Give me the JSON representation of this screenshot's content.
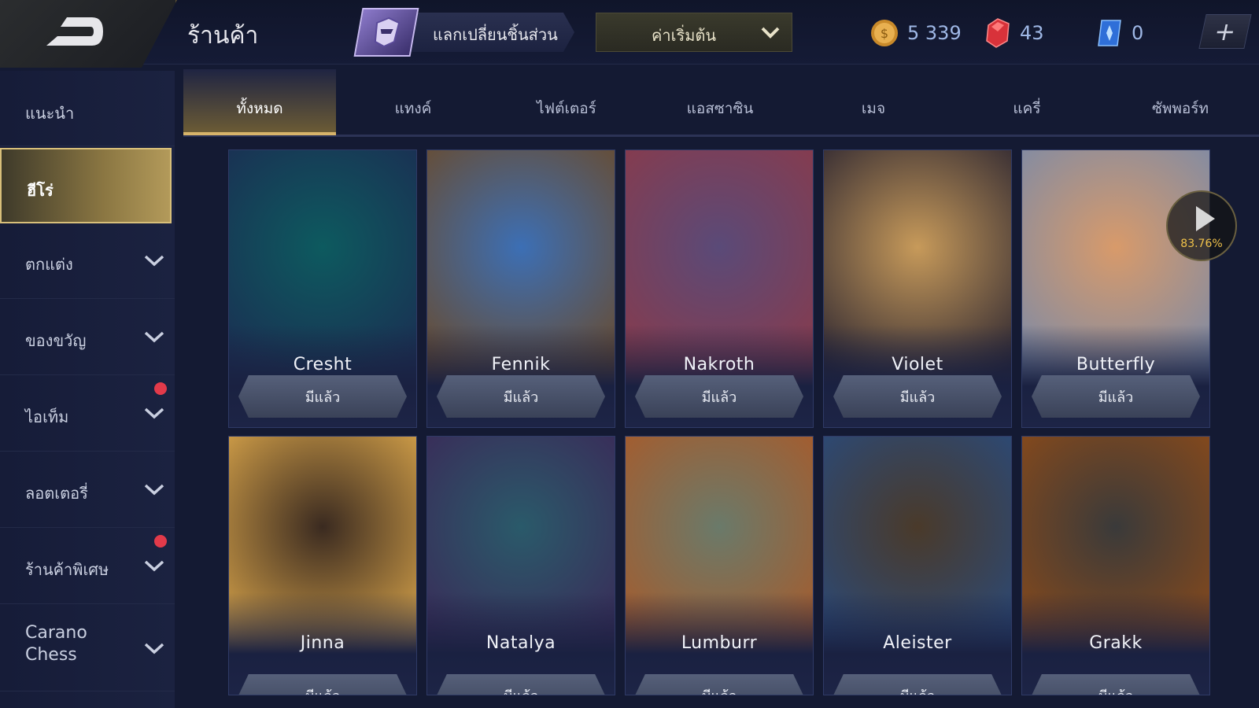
{
  "header": {
    "title": "ร้านค้า",
    "exchange_label": "แลกเปลี่ยนชิ้นส่วน",
    "sort_label": "ค่าเริ่มต้น",
    "currencies": [
      {
        "name": "gold-coin",
        "value": "5 339",
        "color": "#e2a23a"
      },
      {
        "name": "red-gem",
        "value": "43",
        "color": "#e03a3a"
      },
      {
        "name": "blue-voucher",
        "value": "0",
        "color": "#3a7ee0"
      }
    ],
    "plus_label": "+"
  },
  "sidebar": {
    "items": [
      {
        "label": "แนะนำ"
      },
      {
        "label": "ฮีโร่"
      },
      {
        "label": "ตกแต่ง"
      },
      {
        "label": "ของขวัญ"
      },
      {
        "label": "ไอเท็ม"
      },
      {
        "label": "ลอตเตอรี่"
      },
      {
        "label": "ร้านค้าพิเศษ"
      },
      {
        "label": "Carano Chess"
      }
    ]
  },
  "tabs": [
    {
      "label": "ทั้งหมด"
    },
    {
      "label": "แทงค์"
    },
    {
      "label": "ไฟต์เตอร์"
    },
    {
      "label": "แอสซาซิน"
    },
    {
      "label": "เมจ"
    },
    {
      "label": "แครี่"
    },
    {
      "label": "ซัพพอร์ท"
    }
  ],
  "heroes": [
    {
      "name": "Cresht",
      "status": "มีแล้ว",
      "c1": "#0d5a5f",
      "c2": "#1b2d52"
    },
    {
      "name": "Fennik",
      "status": "มีแล้ว",
      "c1": "#3c6fb5",
      "c2": "#6a4a2a"
    },
    {
      "name": "Nakroth",
      "status": "มีแล้ว",
      "c1": "#5a4a78",
      "c2": "#8a3a4a"
    },
    {
      "name": "Violet",
      "status": "มีแล้ว",
      "c1": "#c79a5a",
      "c2": "#2a2430"
    },
    {
      "name": "Butterfly",
      "status": "มีแล้ว",
      "c1": "#d89a6a",
      "c2": "#7a8aa8"
    },
    {
      "name": "Jinna",
      "status": "มีแล้ว",
      "c1": "#3a2a20",
      "c2": "#d8a44a"
    },
    {
      "name": "Natalya",
      "status": "มีแล้ว",
      "c1": "#2a5a6a",
      "c2": "#3a2a58"
    },
    {
      "name": "Lumburr",
      "status": "มีแล้ว",
      "c1": "#6a7a6a",
      "c2": "#a85a2a"
    },
    {
      "name": "Aleister",
      "status": "มีแล้ว",
      "c1": "#4a3a2a",
      "c2": "#2a4a7a"
    },
    {
      "name": "Grakk",
      "status": "มีแล้ว",
      "c1": "#3a3a3a",
      "c2": "#8a4a1a"
    }
  ],
  "video_badge": {
    "progress": "83.76%"
  }
}
